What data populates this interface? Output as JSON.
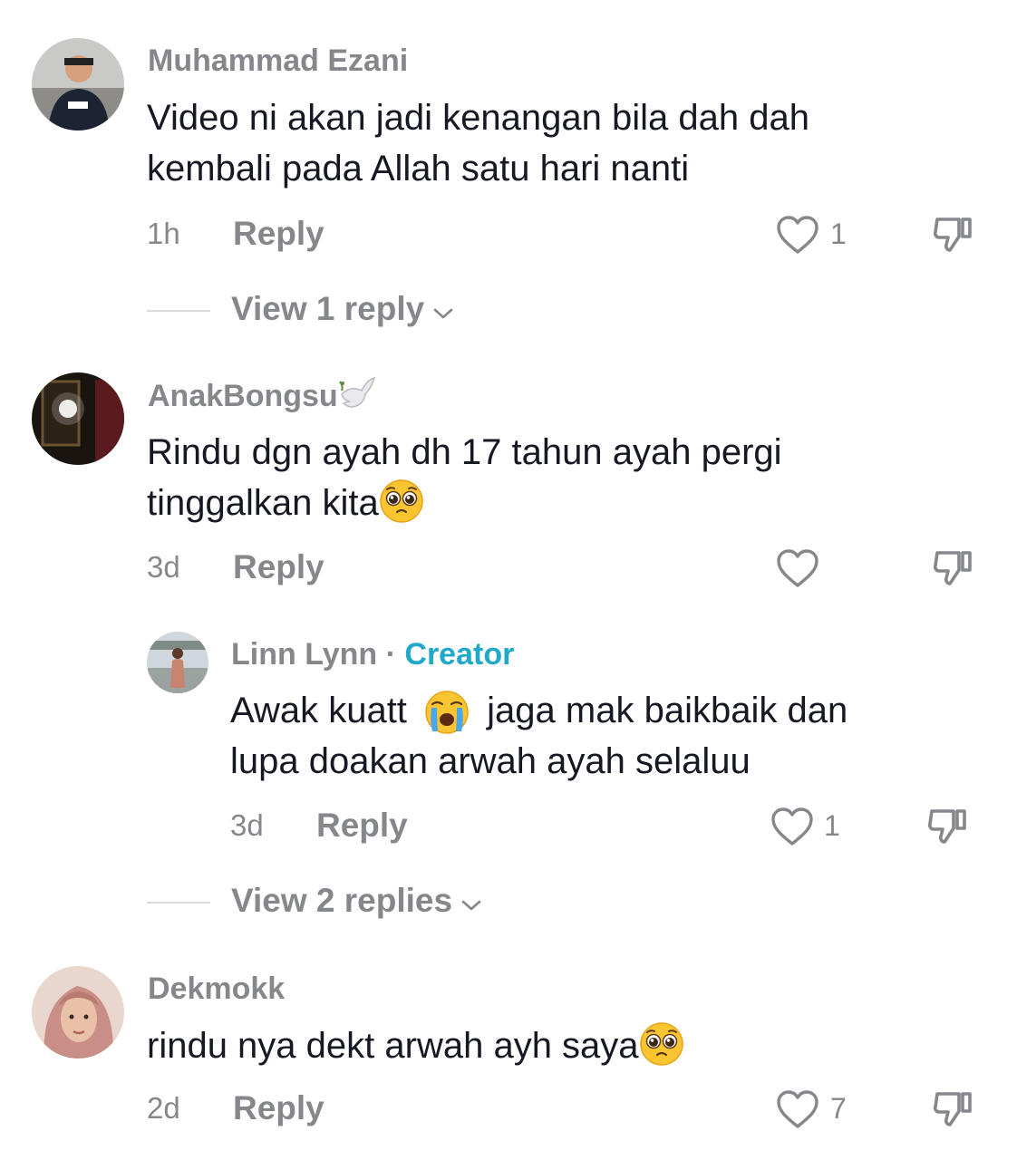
{
  "comments": [
    {
      "username": "Muhammad Ezani",
      "text_line1": "Video ni akan jadi kenangan bila dah dah",
      "text_line2": "kembali pada Allah satu hari nanti",
      "time": "1h",
      "reply_label": "Reply",
      "likes": "1",
      "view_replies": "View 1 reply"
    },
    {
      "username": "AnakBongsu",
      "name_icon": "dove-icon",
      "text_line1": "Rindu dgn ayah dh 17 tahun ayah pergi",
      "text_line2": "tinggalkan kita",
      "text_emoji": "pleading-face-emoji",
      "time": "3d",
      "reply_label": "Reply",
      "likes": ""
    },
    {
      "username": "Linn Lynn",
      "separator": "·",
      "badge": "Creator",
      "text_line1_a": "Awak kuatt",
      "text_line1_b": "jaga mak baikbaik dan",
      "text_emoji": "loudly-crying-face-emoji",
      "text_line2": "lupa doakan arwah ayah selaluu",
      "time": "3d",
      "reply_label": "Reply",
      "likes": "1",
      "view_replies": "View 2 replies"
    },
    {
      "username": "Dekmokk",
      "text_line1": "rindu nya dekt arwah ayh saya",
      "text_emoji": "pleading-face-emoji",
      "time": "2d",
      "reply_label": "Reply",
      "likes": "7"
    }
  ],
  "colors": {
    "secondary_text": "#86878b",
    "primary_text": "#161823",
    "creator_badge": "#20a9c8",
    "divider": "#d9d9db"
  }
}
